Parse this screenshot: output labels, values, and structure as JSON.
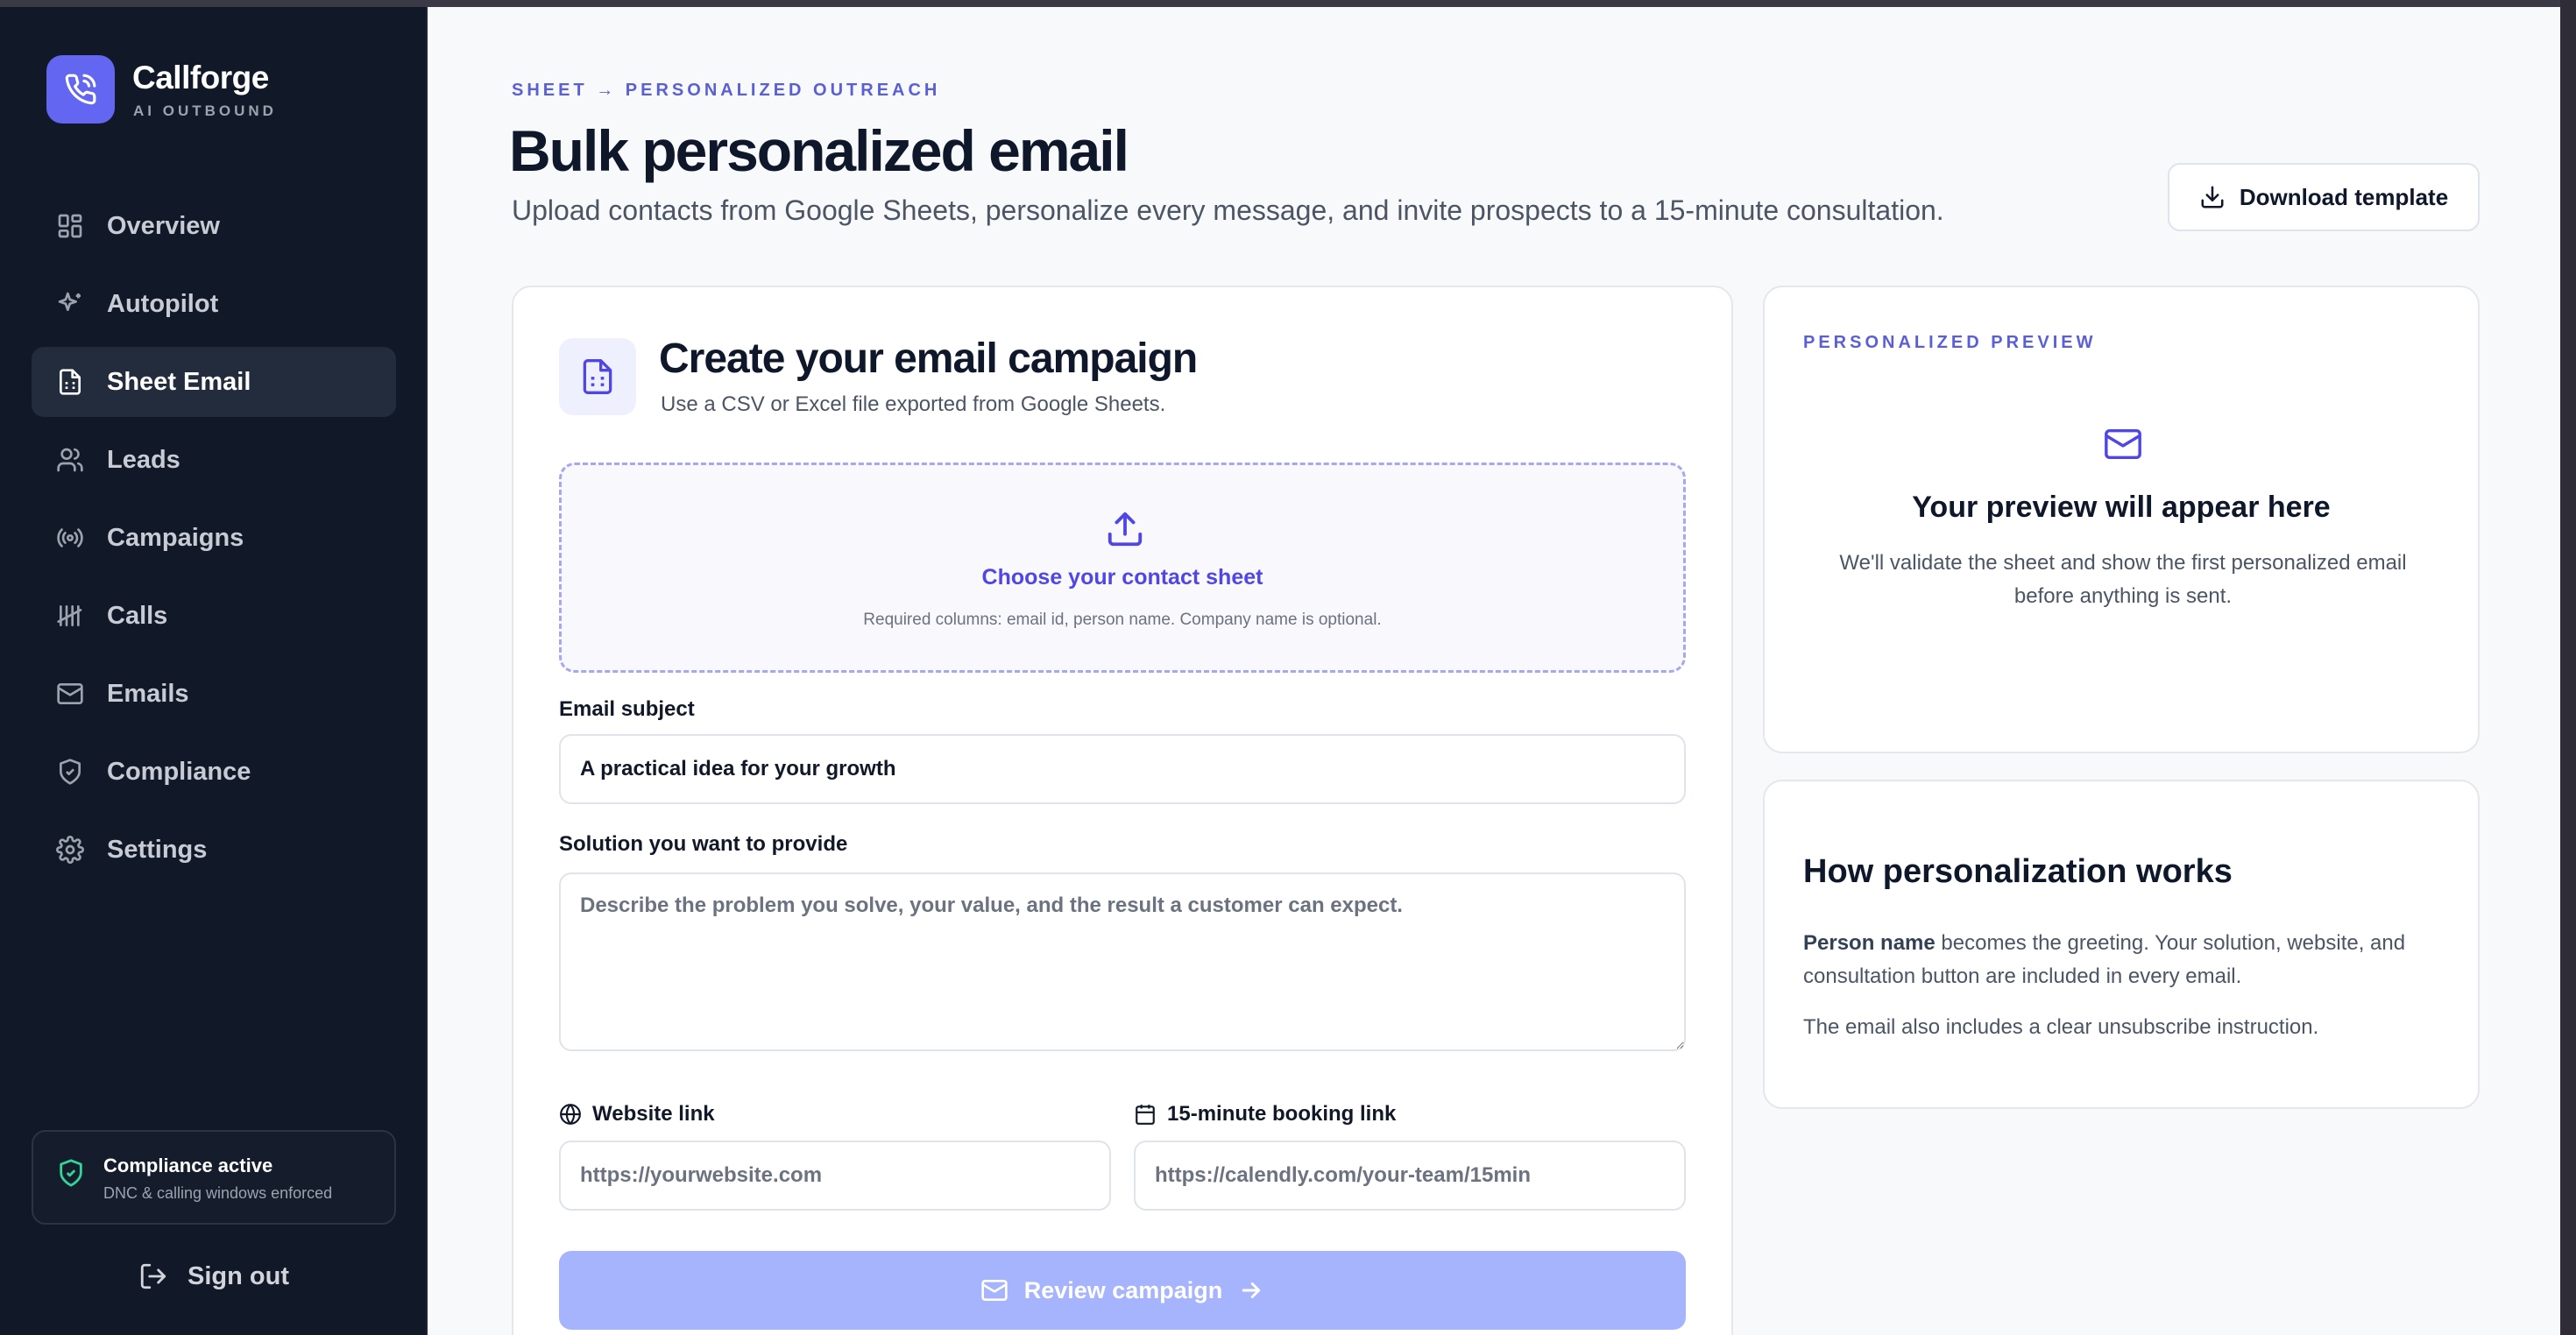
{
  "colors": {
    "accent": "#6366f1",
    "sidebar_bg": "#111827",
    "main_bg": "#f8f9fb",
    "success": "#34d399",
    "button_disabled": "#a5b4fc"
  },
  "brand": {
    "name": "Callforge",
    "tagline": "AI OUTBOUND",
    "logo_icon": "phone-call-icon"
  },
  "sidebar": {
    "items": [
      {
        "label": "Overview",
        "icon": "grid-icon"
      },
      {
        "label": "Autopilot",
        "icon": "sparkles-icon"
      },
      {
        "label": "Sheet Email",
        "icon": "sheet-icon",
        "active": true
      },
      {
        "label": "Leads",
        "icon": "users-icon"
      },
      {
        "label": "Campaigns",
        "icon": "radio-icon"
      },
      {
        "label": "Calls",
        "icon": "tally-icon"
      },
      {
        "label": "Emails",
        "icon": "mail-icon"
      },
      {
        "label": "Compliance",
        "icon": "shield-icon"
      },
      {
        "label": "Settings",
        "icon": "gear-icon"
      }
    ],
    "compliance": {
      "title": "Compliance active",
      "subtitle": "DNC & calling windows enforced"
    },
    "signout_label": "Sign out"
  },
  "header": {
    "breadcrumb": "SHEET → PERSONALIZED OUTREACH",
    "title": "Bulk personalized email",
    "subtitle": "Upload contacts from Google Sheets, personalize every message, and invite prospects to a 15-minute consultation.",
    "download_label": "Download template"
  },
  "campaign": {
    "title": "Create your email campaign",
    "subtitle": "Use a CSV or Excel file exported from Google Sheets.",
    "upload": {
      "title": "Choose your contact sheet",
      "hint": "Required columns: email id, person name. Company name is optional."
    },
    "subject": {
      "label": "Email subject",
      "value": "A practical idea for your growth"
    },
    "solution": {
      "label": "Solution you want to provide",
      "placeholder": "Describe the problem you solve, your value, and the result a customer can expect."
    },
    "website": {
      "label": "Website link",
      "placeholder": "https://yourwebsite.com"
    },
    "booking": {
      "label": "15-minute booking link",
      "placeholder": "https://calendly.com/your-team/15min"
    },
    "review_label": "Review campaign"
  },
  "preview": {
    "label": "PERSONALIZED PREVIEW",
    "title": "Your preview will appear here",
    "subtitle": "We'll validate the sheet and show the first personalized email before anything is sent."
  },
  "how": {
    "title": "How personalization works",
    "p1_bold": "Person name",
    "p1_rest": " becomes the greeting. Your solution, website, and consultation button are included in every email.",
    "p2": "The email also includes a clear unsubscribe instruction."
  }
}
